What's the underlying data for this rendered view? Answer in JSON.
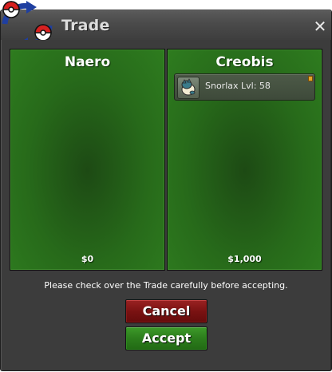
{
  "window": {
    "title": "Trade",
    "close_glyph": "✕"
  },
  "offers": [
    {
      "player": "Naero",
      "money": "$0",
      "items": []
    },
    {
      "player": "Creobis",
      "money": "$1,000",
      "items": [
        {
          "label": "Snorlax  Lvl: 58",
          "icon": "snorlax-icon",
          "locked": true
        }
      ]
    }
  ],
  "notice": "Please check over the Trade carefully before accepting.",
  "buttons": {
    "cancel": "Cancel",
    "accept": "Accept"
  },
  "colors": {
    "cancel": "#7a1212",
    "accept": "#2c7d1c",
    "pane": "#276a1a"
  }
}
